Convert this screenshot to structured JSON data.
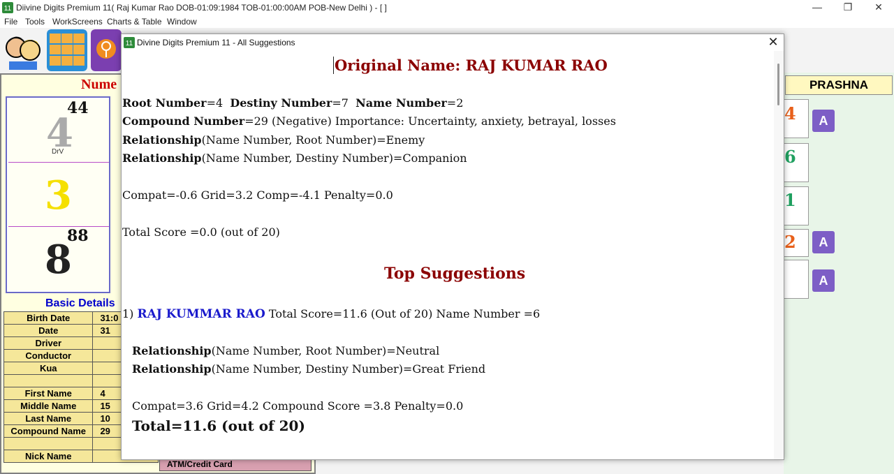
{
  "window": {
    "title": "Diivine Digits Premium 11( Raj Kumar Rao DOB-01:09:1984 TOB-01:00:00AM POB-New Delhi ) - [ ]",
    "min_glyph": "—",
    "max_glyph": "❐",
    "close_glyph": "✕"
  },
  "menu": [
    "File",
    "Tools",
    "WorkScreens",
    "Charts & Table",
    "Window"
  ],
  "left_panel": {
    "title_partial": "Nume",
    "grid": {
      "cells": [
        {
          "number": "4",
          "super": "44",
          "label": "DrV"
        },
        {
          "number": "3",
          "super": "",
          "label": ""
        },
        {
          "number": "8",
          "super": "88",
          "label": ""
        }
      ]
    },
    "basic_details_title": "Basic Details",
    "details": [
      {
        "label": "Birth Date",
        "value": "31:0"
      },
      {
        "label": "Date",
        "value": "31"
      },
      {
        "label": "Driver",
        "value": ""
      },
      {
        "label": "Conductor",
        "value": ""
      },
      {
        "label": "Kua",
        "value": ""
      },
      {
        "label": "",
        "value": ""
      },
      {
        "label": "First Name",
        "value": "4"
      },
      {
        "label": "Middle Name",
        "value": "15"
      },
      {
        "label": "Last Name",
        "value": "10"
      },
      {
        "label": "Compound Name",
        "value": "29"
      },
      {
        "label": "",
        "value": ""
      },
      {
        "label": "Nick Name",
        "value": ""
      }
    ],
    "atm_label": "ATM/Credit Card"
  },
  "right_panel": {
    "title": "PRASHNA",
    "numbers": [
      "4",
      "6",
      "1",
      "2",
      ""
    ]
  },
  "dialog": {
    "title": "Divine Digits Premium 11 - All Suggestions",
    "original_name_heading": "Original Name: RAJ KUMAR RAO",
    "root_label": "Root Number",
    "root_value": "=4",
    "destiny_label": "Destiny Number",
    "destiny_value": "=7",
    "name_label": "Name Number",
    "name_value": "=2",
    "compound_label": "Compound Number",
    "compound_value": "=29 (Negative)  Importance: Uncertainty, anxiety, betrayal, losses",
    "relationship_label": "Relationship",
    "rel1_text": "(Name Number, Root Number)=Enemy",
    "rel2_text": "(Name Number, Destiny Number)=Companion",
    "scores_line": "Compat=-0.6    Grid=3.2    Comp=-4.1    Penalty=0.0",
    "total_line": "Total Score =0.0 (out of 20)",
    "top_heading": "Top Suggestions",
    "suggestions": [
      {
        "index": "1)",
        "name": "RAJ KUMMAR RAO",
        "summary": "Total Score=11.6 (Out of 20)  Name Number =6",
        "rel1_text": "(Name Number, Root Number)=Neutral",
        "rel2_text": "(Name Number, Destiny Number)=Great Friend",
        "scores_line": "Compat=3.6   Grid=4.2   Compound Score =3.8   Penalty=0.0",
        "total_line": "Total=11.6 (out of 20)"
      }
    ]
  },
  "colors": {
    "heading_red": "#8b0000",
    "suggestion_blue": "#1a1acc",
    "grid_yellow": "#f5e000",
    "prashna_bg": "#fff8c0"
  }
}
